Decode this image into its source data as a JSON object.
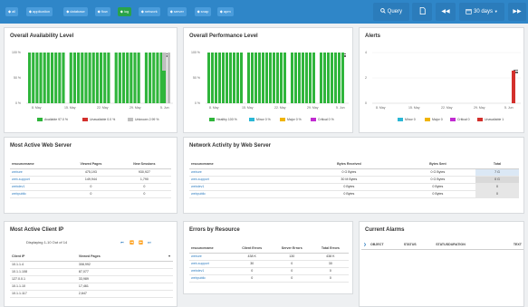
{
  "topbar": {
    "tags": [
      {
        "label": "all",
        "active": false
      },
      {
        "label": "application",
        "active": false
      },
      {
        "label": "database",
        "active": false
      },
      {
        "label": "flow",
        "active": false
      },
      {
        "label": "log",
        "active": true
      },
      {
        "label": "network",
        "active": false
      },
      {
        "label": "server",
        "active": false
      },
      {
        "label": "snap",
        "active": false
      },
      {
        "label": "apm",
        "active": false
      }
    ],
    "query_label": "Query",
    "range_label": "30 days",
    "colors": {
      "bar": "#2f86c8",
      "button": "#2b7cbb",
      "active_tag": "#29a34a"
    }
  },
  "availability": {
    "title": "Overall Availability Level",
    "y_ticks": [
      "100 %",
      "50 %",
      "0 %"
    ],
    "x_ticks": [
      "8. May",
      "15. May",
      "22. May",
      "29. May",
      "5. Jun"
    ],
    "legend": [
      {
        "label": "Available 97.0 %",
        "color": "#2fb53b"
      },
      {
        "label": "Unavailable 0.0 %",
        "color": "#d3302c"
      },
      {
        "label": "Unknown 2.99 %",
        "color": "#bfbfbf"
      }
    ]
  },
  "performance": {
    "title": "Overall Performance Level",
    "y_ticks": [
      "100 %",
      "50 %",
      "0 %"
    ],
    "x_ticks": [
      "8. May",
      "15. May",
      "22. May",
      "29. May",
      "5. Jun"
    ],
    "legend": [
      {
        "label": "Healthy 100 %",
        "color": "#2fb53b"
      },
      {
        "label": "Minor 0 %",
        "color": "#2ab7d6"
      },
      {
        "label": "Major 0 %",
        "color": "#f0b400"
      },
      {
        "label": "Critical 0 %",
        "color": "#c12bd1"
      }
    ]
  },
  "alerts": {
    "title": "Alerts",
    "y_ticks": [
      "4",
      "2",
      "0"
    ],
    "x_ticks": [
      "8. May",
      "15. May",
      "22. May",
      "29. May",
      "5. Jun"
    ],
    "legend": [
      {
        "label": "Minor 0",
        "color": "#2ab7d6"
      },
      {
        "label": "Major 0",
        "color": "#f0b400"
      },
      {
        "label": "Critical 0",
        "color": "#c12bd1"
      },
      {
        "label": "Unavailable 1",
        "color": "#d3302c"
      }
    ]
  },
  "web_server": {
    "title": "Most Active Web Server",
    "columns": [
      "resourcename",
      "Viewed Pages",
      "New Sessions"
    ],
    "rows": [
      [
        "webure",
        "475,193",
        "930,927"
      ],
      [
        "web-support",
        "149,944",
        "1,790"
      ],
      [
        "webdev1",
        "0",
        "0"
      ],
      [
        "webpublic",
        "0",
        "0"
      ]
    ]
  },
  "network": {
    "title": "Network Activity by Web Server",
    "columns": [
      "resourcename",
      "Bytes Received",
      "Bytes Sent",
      "Total"
    ],
    "rows": [
      [
        "webure",
        "0 G Bytes",
        "0 G Bytes",
        "7 G"
      ],
      [
        "web-support",
        "30 M Bytes",
        "0 G Bytes",
        "0 G"
      ],
      [
        "webdev1",
        "0 Bytes",
        "0 Bytes",
        "0"
      ],
      [
        "webpublic",
        "0 Bytes",
        "0 Bytes",
        "0"
      ]
    ]
  },
  "client_ip": {
    "title": "Most Active Client IP",
    "pager_text": "Displaying 1-10 Out of 14",
    "columns": [
      "Client IP",
      "Viewed Pages"
    ],
    "rows": [
      [
        "10.1.1.4",
        "308,992"
      ],
      [
        "10.1.1.108",
        "87,077"
      ],
      [
        "127.0.0.1",
        "33,989"
      ],
      [
        "10.1.1.10",
        "17,461"
      ],
      [
        "10.1.1.117",
        "2,647"
      ]
    ]
  },
  "errors": {
    "title": "Errors by Resource",
    "columns": [
      "resourcename",
      "Client Errors",
      "Server Errors",
      "Total Errors"
    ],
    "rows": [
      [
        "webure",
        "438 K",
        "130",
        "438 K"
      ],
      [
        "web-support",
        "30",
        "0",
        "30"
      ],
      [
        "webdev1",
        "0",
        "0",
        "0"
      ],
      [
        "webpublic",
        "0",
        "0",
        "0"
      ]
    ]
  },
  "current_alarms": {
    "title": "Current Alarms",
    "columns": [
      "OBJECT",
      "STATUS",
      "STATUSDURATION",
      "TEXT"
    ]
  }
}
